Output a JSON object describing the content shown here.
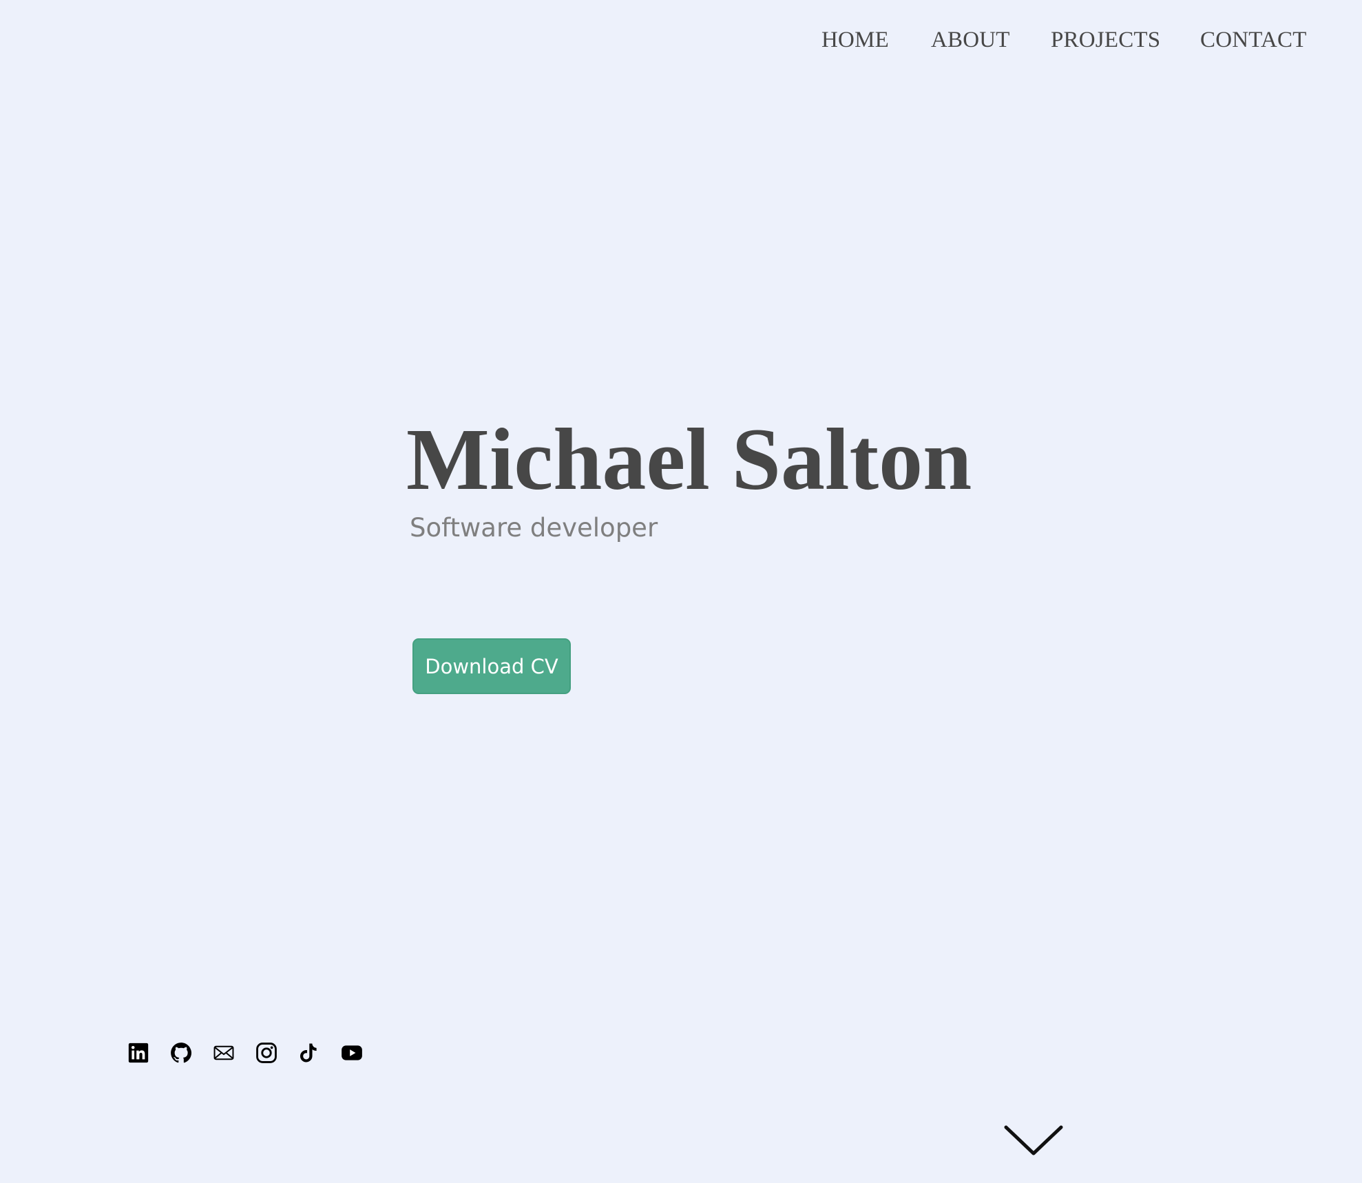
{
  "nav": {
    "items": [
      {
        "label": "HOME"
      },
      {
        "label": "ABOUT"
      },
      {
        "label": "PROJECTS"
      },
      {
        "label": "CONTACT"
      }
    ]
  },
  "hero": {
    "name": "Michael Salton",
    "title": "Software developer",
    "cv_button_label": "Download CV"
  },
  "socials": [
    {
      "icon": "linkedin-icon"
    },
    {
      "icon": "github-icon"
    },
    {
      "icon": "email-icon"
    },
    {
      "icon": "instagram-icon"
    },
    {
      "icon": "tiktok-icon"
    },
    {
      "icon": "youtube-icon"
    }
  ],
  "scroll": {
    "icon": "chevron-down-icon"
  },
  "colors": {
    "background": "#edf1fb",
    "text": "#474747",
    "subtitle": "#7f7f7f",
    "accent": "#4eaa8c"
  }
}
